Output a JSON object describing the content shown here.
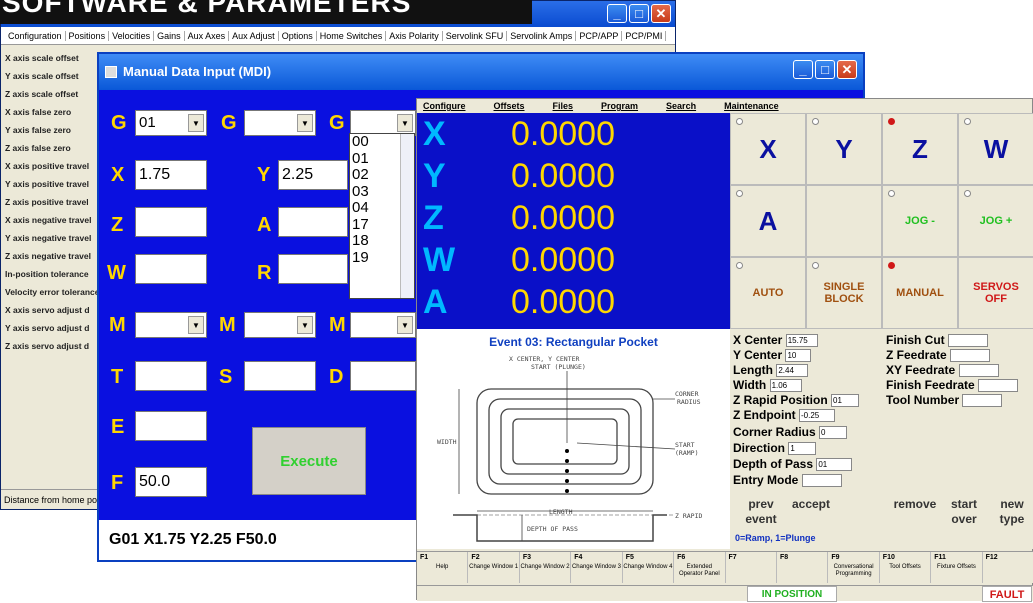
{
  "banner": {
    "text": "SOFTWARE & PARAMETERS"
  },
  "config": {
    "tabs": [
      "Configuration",
      "Positions",
      "Velocities",
      "Gains",
      "Aux Axes",
      "Aux Adjust",
      "Options",
      "Home Switches",
      "Axis Polarity",
      "Servolink SFU",
      "Servolink Amps",
      "PCP/APP",
      "PCP/PMI"
    ],
    "items": [
      "X axis scale offset",
      "Y axis scale offset",
      "Z axis scale offset",
      "X axis false zero",
      "Y axis false zero",
      "Z axis false zero",
      "X axis positive travel",
      "Y axis positive travel",
      "Z axis positive travel",
      "X axis negative travel",
      "Y axis negative travel",
      "Z axis negative travel",
      "In-position tolerance",
      "Velocity error tolerance",
      "X axis servo adjust d",
      "Y axis servo adjust d",
      "Z axis servo adjust d"
    ],
    "status": "Distance from home po"
  },
  "mdi": {
    "title": "Manual Data Input (MDI)",
    "g_label": "G",
    "g1_value": "01",
    "x_label": "X",
    "x_value": "1.75",
    "y_label": "Y",
    "y_value": "2.25",
    "z_label": "Z",
    "a_label": "A",
    "w_label": "W",
    "r_label": "R",
    "m_label": "M",
    "t_label": "T",
    "s_label": "S",
    "d_label": "D",
    "e_label": "E",
    "f_label": "F",
    "f_value": "50.0",
    "dropdown_options": [
      "00",
      "01",
      "02",
      "03",
      "04",
      "17",
      "18",
      "19"
    ],
    "execute_label": "Execute",
    "command": "G01 X1.75 Y2.25 F50.0"
  },
  "cnc": {
    "menu": [
      "Configure",
      "Offsets",
      "Files",
      "Program",
      "Search",
      "Maintenance"
    ],
    "dro": [
      {
        "axis": "X",
        "value": "0.0000"
      },
      {
        "axis": "Y",
        "value": "0.0000"
      },
      {
        "axis": "Z",
        "value": "0.0000"
      },
      {
        "axis": "W",
        "value": "0.0000"
      },
      {
        "axis": "A",
        "value": "0.0000"
      }
    ],
    "axis_buttons": {
      "x": "X",
      "y": "Y",
      "z": "Z",
      "w": "W",
      "a": "A",
      "jog_minus": "JOG -",
      "jog_plus": "JOG +",
      "auto": "AUTO",
      "single_block": "SINGLE BLOCK",
      "manual": "MANUAL",
      "servos_off": "SERVOS OFF"
    },
    "event_title": "Event 03: Rectangular Pocket",
    "diagram": {
      "center_label": "X CENTER, Y CENTER",
      "start_plunge": "START (PLUNGE)",
      "corner": "CORNER",
      "radius": "RADIUS",
      "width": "WIDTH",
      "start": "START",
      "ramp": "(RAMP)",
      "length": "LENGTH",
      "z_rapid": "Z RAPID",
      "depth": "DEPTH OF PASS"
    },
    "params": {
      "x_center": "X Center",
      "x_center_v": "15.75",
      "y_center": "Y Center",
      "y_center_v": "10",
      "length": "Length",
      "length_v": "2.44",
      "width": "Width",
      "width_v": "1.06",
      "z_rapid": "Z Rapid Position",
      "z_rapid_v": "01",
      "z_end": "Z Endpoint",
      "z_end_v": "-0.25",
      "corner": "Corner Radius",
      "corner_v": "0",
      "direction": "Direction",
      "direction_v": "1",
      "depth": "Depth of Pass",
      "depth_v": "01",
      "entry": "Entry Mode",
      "finish_cut": "Finish Cut",
      "z_feed": "Z Feedrate",
      "xy_feed": "XY Feedrate",
      "finish_feed": "Finish Feedrate",
      "tool": "Tool Number"
    },
    "buttons": {
      "prev_event": "prev event",
      "accept": "accept",
      "remove": "remove",
      "start_over": "start over",
      "new_type": "new type"
    },
    "hint": "0=Ramp, 1=Plunge",
    "fkeys": [
      {
        "k": "F1",
        "t": "Help"
      },
      {
        "k": "F2",
        "t": "Change Window 1"
      },
      {
        "k": "F3",
        "t": "Change Window 2"
      },
      {
        "k": "F4",
        "t": "Change Window 3"
      },
      {
        "k": "F5",
        "t": "Change Window 4"
      },
      {
        "k": "F6",
        "t": "Extended Operator Panel"
      },
      {
        "k": "F7",
        "t": ""
      },
      {
        "k": "F8",
        "t": ""
      },
      {
        "k": "F9",
        "t": "Conversational Programming"
      },
      {
        "k": "F10",
        "t": "Tool Offsets"
      },
      {
        "k": "F11",
        "t": "Fixture Offsets"
      },
      {
        "k": "F12",
        "t": ""
      }
    ],
    "status_inpos": "IN POSITION",
    "status_fault": "FAULT"
  }
}
